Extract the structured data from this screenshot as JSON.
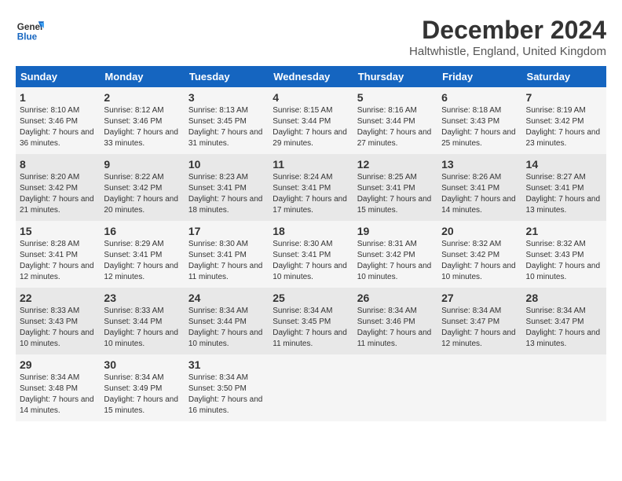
{
  "header": {
    "logo_line1": "General",
    "logo_line2": "Blue",
    "month": "December 2024",
    "location": "Haltwhistle, England, United Kingdom"
  },
  "days_of_week": [
    "Sunday",
    "Monday",
    "Tuesday",
    "Wednesday",
    "Thursday",
    "Friday",
    "Saturday"
  ],
  "weeks": [
    [
      {
        "day": "1",
        "sunrise": "8:10 AM",
        "sunset": "3:46 PM",
        "daylight": "7 hours and 36 minutes."
      },
      {
        "day": "2",
        "sunrise": "8:12 AM",
        "sunset": "3:46 PM",
        "daylight": "7 hours and 33 minutes."
      },
      {
        "day": "3",
        "sunrise": "8:13 AM",
        "sunset": "3:45 PM",
        "daylight": "7 hours and 31 minutes."
      },
      {
        "day": "4",
        "sunrise": "8:15 AM",
        "sunset": "3:44 PM",
        "daylight": "7 hours and 29 minutes."
      },
      {
        "day": "5",
        "sunrise": "8:16 AM",
        "sunset": "3:44 PM",
        "daylight": "7 hours and 27 minutes."
      },
      {
        "day": "6",
        "sunrise": "8:18 AM",
        "sunset": "3:43 PM",
        "daylight": "7 hours and 25 minutes."
      },
      {
        "day": "7",
        "sunrise": "8:19 AM",
        "sunset": "3:42 PM",
        "daylight": "7 hours and 23 minutes."
      }
    ],
    [
      {
        "day": "8",
        "sunrise": "8:20 AM",
        "sunset": "3:42 PM",
        "daylight": "7 hours and 21 minutes."
      },
      {
        "day": "9",
        "sunrise": "8:22 AM",
        "sunset": "3:42 PM",
        "daylight": "7 hours and 20 minutes."
      },
      {
        "day": "10",
        "sunrise": "8:23 AM",
        "sunset": "3:41 PM",
        "daylight": "7 hours and 18 minutes."
      },
      {
        "day": "11",
        "sunrise": "8:24 AM",
        "sunset": "3:41 PM",
        "daylight": "7 hours and 17 minutes."
      },
      {
        "day": "12",
        "sunrise": "8:25 AM",
        "sunset": "3:41 PM",
        "daylight": "7 hours and 15 minutes."
      },
      {
        "day": "13",
        "sunrise": "8:26 AM",
        "sunset": "3:41 PM",
        "daylight": "7 hours and 14 minutes."
      },
      {
        "day": "14",
        "sunrise": "8:27 AM",
        "sunset": "3:41 PM",
        "daylight": "7 hours and 13 minutes."
      }
    ],
    [
      {
        "day": "15",
        "sunrise": "8:28 AM",
        "sunset": "3:41 PM",
        "daylight": "7 hours and 12 minutes."
      },
      {
        "day": "16",
        "sunrise": "8:29 AM",
        "sunset": "3:41 PM",
        "daylight": "7 hours and 12 minutes."
      },
      {
        "day": "17",
        "sunrise": "8:30 AM",
        "sunset": "3:41 PM",
        "daylight": "7 hours and 11 minutes."
      },
      {
        "day": "18",
        "sunrise": "8:30 AM",
        "sunset": "3:41 PM",
        "daylight": "7 hours and 10 minutes."
      },
      {
        "day": "19",
        "sunrise": "8:31 AM",
        "sunset": "3:42 PM",
        "daylight": "7 hours and 10 minutes."
      },
      {
        "day": "20",
        "sunrise": "8:32 AM",
        "sunset": "3:42 PM",
        "daylight": "7 hours and 10 minutes."
      },
      {
        "day": "21",
        "sunrise": "8:32 AM",
        "sunset": "3:43 PM",
        "daylight": "7 hours and 10 minutes."
      }
    ],
    [
      {
        "day": "22",
        "sunrise": "8:33 AM",
        "sunset": "3:43 PM",
        "daylight": "7 hours and 10 minutes."
      },
      {
        "day": "23",
        "sunrise": "8:33 AM",
        "sunset": "3:44 PM",
        "daylight": "7 hours and 10 minutes."
      },
      {
        "day": "24",
        "sunrise": "8:34 AM",
        "sunset": "3:44 PM",
        "daylight": "7 hours and 10 minutes."
      },
      {
        "day": "25",
        "sunrise": "8:34 AM",
        "sunset": "3:45 PM",
        "daylight": "7 hours and 11 minutes."
      },
      {
        "day": "26",
        "sunrise": "8:34 AM",
        "sunset": "3:46 PM",
        "daylight": "7 hours and 11 minutes."
      },
      {
        "day": "27",
        "sunrise": "8:34 AM",
        "sunset": "3:47 PM",
        "daylight": "7 hours and 12 minutes."
      },
      {
        "day": "28",
        "sunrise": "8:34 AM",
        "sunset": "3:47 PM",
        "daylight": "7 hours and 13 minutes."
      }
    ],
    [
      {
        "day": "29",
        "sunrise": "8:34 AM",
        "sunset": "3:48 PM",
        "daylight": "7 hours and 14 minutes."
      },
      {
        "day": "30",
        "sunrise": "8:34 AM",
        "sunset": "3:49 PM",
        "daylight": "7 hours and 15 minutes."
      },
      {
        "day": "31",
        "sunrise": "8:34 AM",
        "sunset": "3:50 PM",
        "daylight": "7 hours and 16 minutes."
      },
      null,
      null,
      null,
      null
    ]
  ]
}
